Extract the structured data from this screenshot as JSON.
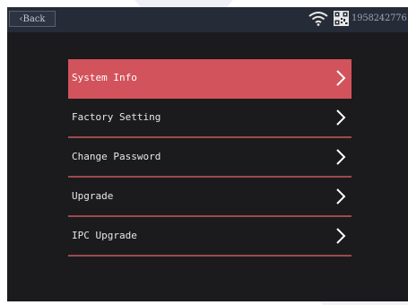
{
  "status_bar": {
    "back_label": "‹Back",
    "wifi_icon": "wifi-icon",
    "qr_icon": "qr-code-icon",
    "device_id": "1958242776"
  },
  "menu": {
    "items": [
      {
        "label": "System Info",
        "active": true
      },
      {
        "label": "Factory Setting",
        "active": false
      },
      {
        "label": "Change Password",
        "active": false
      },
      {
        "label": "Upgrade",
        "active": false
      },
      {
        "label": "IPC Upgrade",
        "active": false
      }
    ],
    "chevron_icon": "chevron-right-icon"
  },
  "colors": {
    "screen_bg": "#1b1b1d",
    "status_bar_bg": "#262b38",
    "active_item_bg": "#d2535c",
    "divider": "#9c4a4e",
    "text": "#e6e6e6"
  }
}
